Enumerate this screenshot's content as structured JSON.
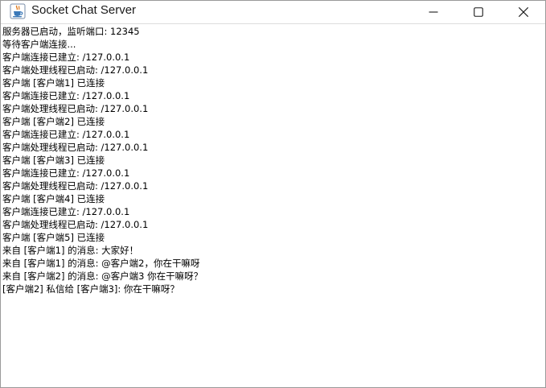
{
  "window": {
    "title": "Socket Chat Server"
  },
  "icons": {
    "app": "java-coffee-icon",
    "minimize": "minimize-icon",
    "maximize": "maximize-icon",
    "close": "close-icon"
  },
  "colors": {
    "icon_blue": "#3a78b8",
    "icon_orange": "#e07b1f"
  },
  "log": {
    "lines": [
      "服务器已启动，监听端口: 12345",
      "等待客户端连接...",
      "客户端连接已建立: /127.0.0.1",
      "客户端处理线程已启动: /127.0.0.1",
      "客户端 [客户端1] 已连接",
      "客户端连接已建立: /127.0.0.1",
      "客户端处理线程已启动: /127.0.0.1",
      "客户端 [客户端2] 已连接",
      "客户端连接已建立: /127.0.0.1",
      "客户端处理线程已启动: /127.0.0.1",
      "客户端 [客户端3] 已连接",
      "客户端连接已建立: /127.0.0.1",
      "客户端处理线程已启动: /127.0.0.1",
      "客户端 [客户端4] 已连接",
      "客户端连接已建立: /127.0.0.1",
      "客户端处理线程已启动: /127.0.0.1",
      "客户端 [客户端5] 已连接",
      "来自 [客户端1] 的消息: 大家好！",
      "来自 [客户端1] 的消息: @客户端2，你在干嘛呀",
      "来自 [客户端2] 的消息: @客户端3 你在干嘛呀？",
      "[客户端2] 私信给 [客户端3]: 你在干嘛呀？"
    ]
  }
}
